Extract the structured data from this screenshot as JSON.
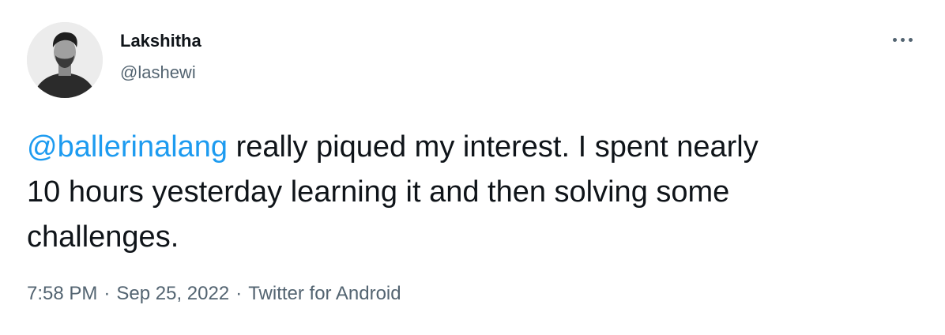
{
  "author": {
    "display_name": "Lakshitha",
    "handle": "@lashewi",
    "avatar_icon": "user-photo-avatar"
  },
  "menu": {
    "icon": "more-horizontal-icon"
  },
  "tweet": {
    "mention": "@ballerinalang",
    "text_line1_rest": " really piqued my interest. I spent nearly",
    "text_line2": "10 hours yesterday learning it and then solving some",
    "text_line3": "challenges."
  },
  "meta": {
    "time": "7:58 PM",
    "separator": "·",
    "date": "Sep 25, 2022",
    "source": "Twitter for Android"
  },
  "colors": {
    "link": "#1d9bf0",
    "text": "#0f1419",
    "secondary": "#536471"
  }
}
